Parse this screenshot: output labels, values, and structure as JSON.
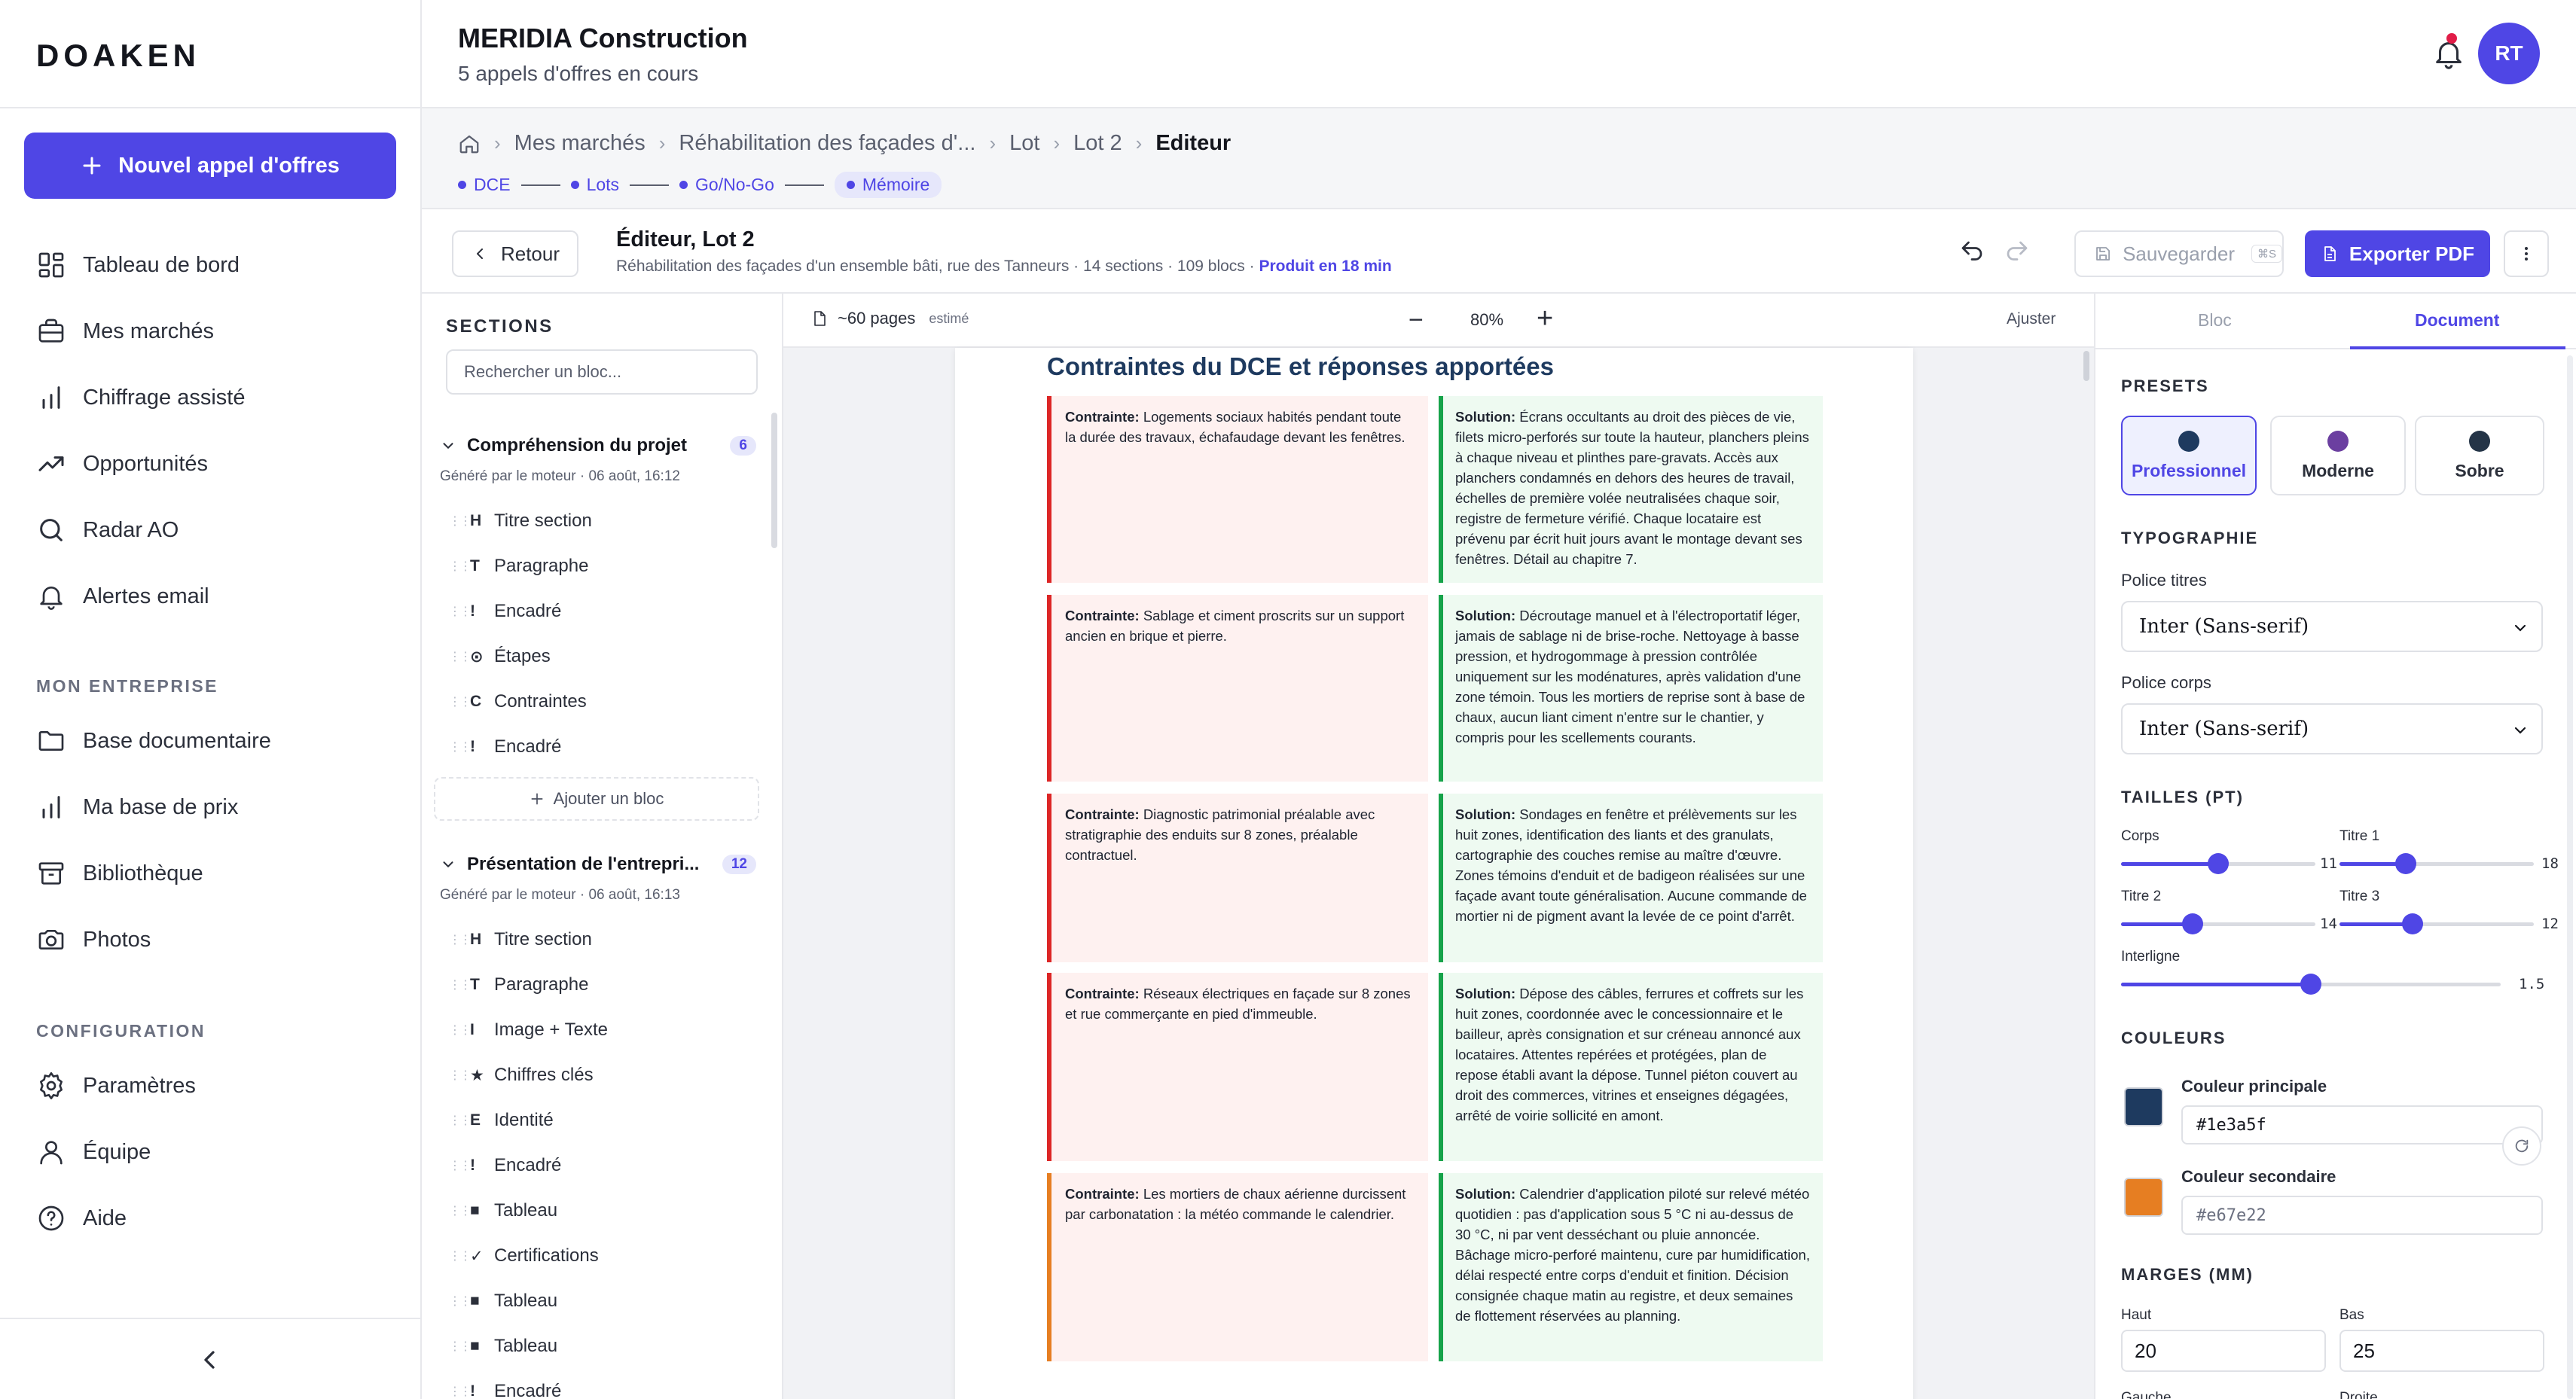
{
  "sidebar": {
    "logo": "DOAKEN",
    "new_button": "Nouvel appel d'offres",
    "nav": [
      {
        "label": "Tableau de bord",
        "icon": "dashboard-icon"
      },
      {
        "label": "Mes marchés",
        "icon": "briefcase-icon"
      },
      {
        "label": "Chiffrage assisté",
        "icon": "bar-chart-icon"
      },
      {
        "label": "Opportunités",
        "icon": "trending-up-icon"
      },
      {
        "label": "Radar AO",
        "icon": "search-icon"
      },
      {
        "label": "Alertes email",
        "icon": "bell-icon"
      }
    ],
    "section_company": "MON ENTREPRISE",
    "company_nav": [
      {
        "label": "Base documentaire",
        "icon": "folder-icon"
      },
      {
        "label": "Ma base de prix",
        "icon": "bar-chart-icon"
      },
      {
        "label": "Bibliothèque",
        "icon": "archive-icon"
      },
      {
        "label": "Photos",
        "icon": "camera-icon"
      }
    ],
    "section_config": "CONFIGURATION",
    "config_nav": [
      {
        "label": "Paramètres",
        "icon": "gear-icon"
      },
      {
        "label": "Équipe",
        "icon": "user-icon"
      },
      {
        "label": "Aide",
        "icon": "help-icon"
      }
    ]
  },
  "header": {
    "company": "MERIDIA Construction",
    "subtitle": "5 appels d'offres en cours",
    "avatar": "RT"
  },
  "breadcrumb": [
    "Mes marchés",
    "Réhabilitation des façades d'...",
    "Lot",
    "Lot 2",
    "Editeur"
  ],
  "steps": [
    "DCE",
    "Lots",
    "Go/No-Go",
    "Mémoire"
  ],
  "editor": {
    "back": "Retour",
    "title": "Éditeur, Lot 2",
    "meta": "Réhabilitation des façades d'un ensemble bâti, rue des Tanneurs · 14 sections · 109 blocs · ",
    "produced": "Produit en 18 min",
    "save": "Sauvegarder",
    "save_kbd": "⌘S",
    "export": "Exporter PDF"
  },
  "sections_panel": {
    "title": "SECTIONS",
    "search_placeholder": "Rechercher un bloc...",
    "groups": [
      {
        "title": "Compréhension du projet",
        "count": "6",
        "generated": "Généré par le moteur · 06 août, 16:12",
        "blocks": [
          {
            "icon": "H",
            "label": "Titre section"
          },
          {
            "icon": "T",
            "label": "Paragraphe"
          },
          {
            "icon": "!",
            "label": "Encadré"
          },
          {
            "icon": "⊙",
            "label": "Étapes"
          },
          {
            "icon": "C",
            "label": "Contraintes"
          },
          {
            "icon": "!",
            "label": "Encadré"
          }
        ],
        "add_block": "Ajouter un bloc"
      },
      {
        "title": "Présentation de l'entrepri...",
        "count": "12",
        "generated": "Généré par le moteur · 06 août, 16:13",
        "blocks": [
          {
            "icon": "H",
            "label": "Titre section"
          },
          {
            "icon": "T",
            "label": "Paragraphe"
          },
          {
            "icon": "I",
            "label": "Image + Texte"
          },
          {
            "icon": "★",
            "label": "Chiffres clés"
          },
          {
            "icon": "E",
            "label": "Identité"
          },
          {
            "icon": "!",
            "label": "Encadré"
          },
          {
            "icon": "■",
            "label": "Tableau"
          },
          {
            "icon": "✓",
            "label": "Certifications"
          },
          {
            "icon": "■",
            "label": "Tableau"
          },
          {
            "icon": "■",
            "label": "Tableau"
          },
          {
            "icon": "!",
            "label": "Encadré"
          }
        ]
      }
    ]
  },
  "canvas": {
    "pages": "~60 pages",
    "estimated": "estimé",
    "zoom": "80%",
    "fit": "Ajuster",
    "page_title": "Contraintes du DCE et réponses apportées",
    "constraint_label": "Contrainte:",
    "solution_label": "Solution:",
    "rows": [
      {
        "constraint": "Logements sociaux habités pendant toute la durée des travaux, échafaudage devant les fenêtres.",
        "solution": "Écrans occultants au droit des pièces de vie, filets micro-perforés sur toute la hauteur, planchers pleins à chaque niveau et plinthes pare-gravats. Accès aux planchers condamnés en dehors des heures de travail, échelles de première volée neutralisées chaque soir, registre de fermeture vérifié. Chaque locataire est prévenu par écrit huit jours avant le montage devant ses fenêtres. Détail au chapitre 7.",
        "accent": "#dc2626"
      },
      {
        "constraint": "Sablage et ciment proscrits sur un support ancien en brique et pierre.",
        "solution": "Décroutage manuel et à l'électroportatif léger, jamais de sablage ni de brise-roche. Nettoyage à basse pression, et hydrogommage à pression contrôlée uniquement sur les modénatures, après validation d'une zone témoin. Tous les mortiers de reprise sont à base de chaux, aucun liant ciment n'entre sur le chantier, y compris pour les scellements courants.",
        "accent": "#dc2626"
      },
      {
        "constraint": "Diagnostic patrimonial préalable avec stratigraphie des enduits sur 8 zones, préalable contractuel.",
        "solution": "Sondages en fenêtre et prélèvements sur les huit zones, identification des liants et des granulats, cartographie des couches remise au maître d'œuvre. Zones témoins d'enduit et de badigeon réalisées sur une façade avant toute généralisation. Aucune commande de mortier ni de pigment avant la levée de ce point d'arrêt.",
        "accent": "#dc2626"
      },
      {
        "constraint": "Réseaux électriques en façade sur 8 zones et rue commerçante en pied d'immeuble.",
        "solution": "Dépose des câbles, ferrures et coffrets sur les huit zones, coordonnée avec le concessionnaire et le bailleur, après consignation et sur créneau annoncé aux locataires. Attentes repérées et protégées, plan de repose établi avant la dépose. Tunnel piéton couvert au droit des commerces, vitrines et enseignes dégagées, arrêté de voirie sollicité en amont.",
        "accent": "#dc2626"
      },
      {
        "constraint": "Les mortiers de chaux aérienne durcissent par carbonatation : la météo commande le calendrier.",
        "solution": "Calendrier d'application piloté sur relevé météo quotidien : pas d'application sous 5 °C ni au-dessus de 30 °C, ni par vent desséchant ou pluie annoncée. Bâchage micro-perforé maintenu, cure par humidification, délai respecté entre corps d'enduit et finition. Décision consignée chaque matin au registre, et deux semaines de flottement réservées au planning.",
        "accent": "#e67e22"
      }
    ]
  },
  "right_panel": {
    "tab_block": "Bloc",
    "tab_document": "Document",
    "presets_title": "PRESETS",
    "presets": [
      {
        "label": "Professionnel",
        "color": "#1e3a5f"
      },
      {
        "label": "Moderne",
        "color": "#6b3fa0"
      },
      {
        "label": "Sobre",
        "color": "#243447"
      }
    ],
    "typo_title": "TYPOGRAPHIE",
    "title_font_label": "Police titres",
    "title_font": "Inter (Sans-serif)",
    "body_font_label": "Police corps",
    "body_font": "Inter (Sans-serif)",
    "sizes_title": "TAILLES (PT)",
    "sizes": [
      {
        "label": "Corps",
        "value": "11",
        "fraction": 0.5
      },
      {
        "label": "Titre 1",
        "value": "18",
        "fraction": 0.32
      },
      {
        "label": "Titre 2",
        "value": "14",
        "fraction": 0.35
      },
      {
        "label": "Titre 3",
        "value": "12",
        "fraction": 0.36
      }
    ],
    "interline_label": "Interligne",
    "interline_value": "1.5",
    "interline_fraction": 0.5,
    "colors_title": "COULEURS",
    "primary_label": "Couleur principale",
    "primary_value": "#1e3a5f",
    "secondary_label": "Couleur secondaire",
    "secondary_value": "#e67e22",
    "margins_title": "MARGES (MM)",
    "top_label": "Haut",
    "top_value": "20",
    "bottom_label": "Bas",
    "bottom_value": "25",
    "left_label": "Gauche",
    "right_label": "Droite"
  }
}
